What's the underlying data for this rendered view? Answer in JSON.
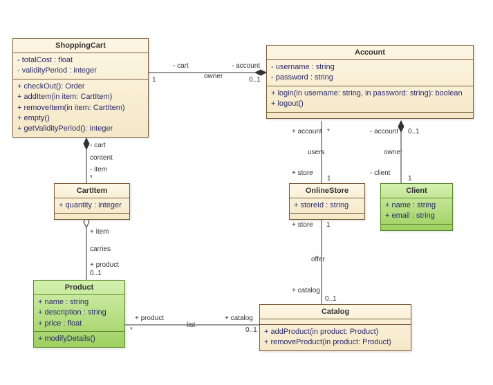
{
  "classes": {
    "shoppingCart": {
      "name": "ShoppingCart",
      "attrs": [
        "- totalCost : float",
        "- validityPeriod : integer"
      ],
      "ops": [
        "+ checkOut(): Order",
        "+ addItem(in item: CartItem)",
        "+ removeItem(in item: CartItem)",
        "+ empty()",
        "+ getValidityPeriod(): integer"
      ]
    },
    "account": {
      "name": "Account",
      "attrs": [
        "- username : string",
        "- password : string"
      ],
      "ops": [
        "+ login(in username: string, in password: string): boolean",
        "+ logout()"
      ]
    },
    "cartItem": {
      "name": "CartItem",
      "attrs": [
        "+ quantity : integer"
      ],
      "ops": []
    },
    "onlineStore": {
      "name": "OnlineStore",
      "attrs": [
        "+ storeId : string"
      ],
      "ops": []
    },
    "client": {
      "name": "Client",
      "attrs": [
        "+ name : string",
        "+ email : string"
      ],
      "ops": []
    },
    "product": {
      "name": "Product",
      "attrs": [
        "+ name : string",
        "+ description : string",
        "+ price : float"
      ],
      "ops": [
        "+ modifyDetails()"
      ]
    },
    "catalog": {
      "name": "Catalog",
      "attrs": [],
      "ops": [
        "+ addProduct(in product: Product)",
        "+ removeProduct(in product: Product)"
      ]
    }
  },
  "labels": {
    "cart1": "- cart",
    "owner1": "owner",
    "account1": "- account",
    "one1": "1",
    "z1_1": "0..1",
    "cart2": "- cart",
    "content": "content",
    "item1": "- item",
    "star1": "*",
    "item2": "+ item",
    "carries": "carries",
    "product1": "+ product",
    "z1_2": "0..1",
    "account2": "+ account",
    "star2": "*",
    "users": "users",
    "store1": "+ store",
    "one2": "1",
    "account3": "- account",
    "z1_3": "0..1",
    "owner2": "owner",
    "client1": "- client",
    "one3": "1",
    "store2": "+ store",
    "one4": "1",
    "offer": "offer",
    "catalog1": "+ catalog",
    "z1_4": "0..1",
    "product2": "+ product",
    "star3": "*",
    "list": "list",
    "catalog2": "+ catalog",
    "z1_5": "0..1"
  },
  "chart_data": {
    "type": "uml-class-diagram",
    "classes": [
      {
        "name": "ShoppingCart",
        "attributes": [
          "- totalCost : float",
          "- validityPeriod : integer"
        ],
        "operations": [
          "+ checkOut(): Order",
          "+ addItem(in item: CartItem)",
          "+ removeItem(in item: CartItem)",
          "+ empty()",
          "+ getValidityPeriod(): integer"
        ],
        "color": "beige"
      },
      {
        "name": "Account",
        "attributes": [
          "- username : string",
          "- password : string"
        ],
        "operations": [
          "+ login(in username: string, in password: string): boolean",
          "+ logout()"
        ],
        "color": "beige"
      },
      {
        "name": "CartItem",
        "attributes": [
          "+ quantity : integer"
        ],
        "operations": [],
        "color": "beige"
      },
      {
        "name": "OnlineStore",
        "attributes": [
          "+ storeId : string"
        ],
        "operations": [],
        "color": "beige"
      },
      {
        "name": "Client",
        "attributes": [
          "+ name : string",
          "+ email : string"
        ],
        "operations": [],
        "color": "green"
      },
      {
        "name": "Product",
        "attributes": [
          "+ name : string",
          "+ description : string",
          "+ price : float"
        ],
        "operations": [
          "+ modifyDetails()"
        ],
        "color": "green"
      },
      {
        "name": "Catalog",
        "attributes": [],
        "operations": [
          "+ addProduct(in product: Product)",
          "+ removeProduct(in product: Product)"
        ],
        "color": "beige"
      }
    ],
    "relationships": [
      {
        "from": "Account",
        "to": "ShoppingCart",
        "type": "composition",
        "name": "owner",
        "from_role": "- account",
        "from_mult": "0..1",
        "to_role": "- cart",
        "to_mult": "1"
      },
      {
        "from": "ShoppingCart",
        "to": "CartItem",
        "type": "composition",
        "name": "content",
        "from_role": "- cart",
        "to_role": "- item",
        "to_mult": "*"
      },
      {
        "from": "CartItem",
        "to": "Product",
        "type": "aggregation",
        "name": "carries",
        "from_role": "+ item",
        "to_role": "+ product",
        "to_mult": "0..1"
      },
      {
        "from": "OnlineStore",
        "to": "Account",
        "type": "association",
        "name": "users",
        "from_role": "+ store",
        "from_mult": "1",
        "to_role": "+ account",
        "to_mult": "*"
      },
      {
        "from": "Account",
        "to": "Client",
        "type": "composition",
        "name": "owner",
        "from_role": "- account",
        "from_mult": "0..1",
        "to_role": "- client",
        "to_mult": "1"
      },
      {
        "from": "OnlineStore",
        "to": "Catalog",
        "type": "association",
        "name": "offer",
        "from_role": "+ store",
        "from_mult": "1",
        "to_role": "+ catalog",
        "to_mult": "0..1"
      },
      {
        "from": "Catalog",
        "to": "Product",
        "type": "association",
        "name": "list",
        "from_role": "+ catalog",
        "from_mult": "0..1",
        "to_role": "+ product",
        "to_mult": "*"
      }
    ]
  }
}
